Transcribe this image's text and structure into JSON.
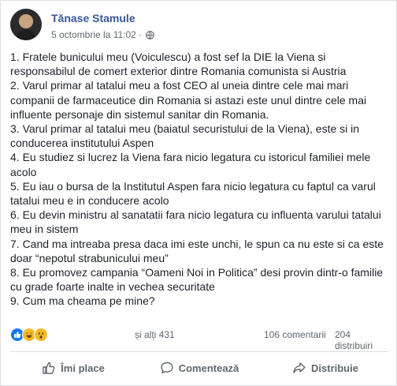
{
  "post": {
    "author": "Tănase Stamule",
    "timestamp": "5 octombrie la 11:02 ·",
    "lines": [
      "1. Fratele bunicului meu (Voiculescu) a fost sef la DIE la Viena si",
      "responsabilul de comert exterior dintre Romania comunista si Austria",
      "2. Varul primar al tatalui meu a fost CEO al uneia dintre cele mai mari",
      "companii de farmaceutice din Romania si astazi este unul dintre cele mai",
      "influente personaje din sistemul sanitar din Romania.",
      "3. Varul primar al tatalui meu (baiatul securistului de la Viena), este si in",
      "conducerea institutului Aspen",
      "4. Eu studiez si lucrez la Viena fara nicio legatura cu istoricul familiei mele",
      "acolo",
      "5. Eu iau o bursa de la Institutul Aspen fara nicio legatura cu faptul ca varul",
      "tatalui meu e in conducere acolo",
      "6. Eu devin ministru al sanatatii fara nicio legatura cu influenta varului tatalui",
      "meu in sistem",
      "7. Cand ma intreaba presa daca imi este unchi, le spun ca nu este si ca este",
      "doar “nepotul strabunicului meu”",
      "8. Eu promovez campania “Oameni Noi in Politica” desi provin dintr-o familie",
      "cu grade foarte inalte in vechea securitate",
      "9. Cum ma cheama pe mine?"
    ]
  },
  "stats": {
    "others": "și alți 431",
    "comments": "106 comentarii",
    "shares": "204 distribuiri"
  },
  "actions": {
    "like": "Îmi place",
    "comment": "Comentează",
    "share": "Distribuie"
  },
  "icons": {
    "reactions": [
      "like-reaction-icon",
      "haha-reaction-icon",
      "wow-reaction-icon"
    ],
    "like": "thumbs-up-icon",
    "comment": "speech-bubble-icon",
    "share": "share-arrow-icon",
    "privacy": "globe-icon"
  },
  "colors": {
    "author": "#385898",
    "like_reaction": "#1877f2",
    "haha_reaction": "#f7b928"
  }
}
